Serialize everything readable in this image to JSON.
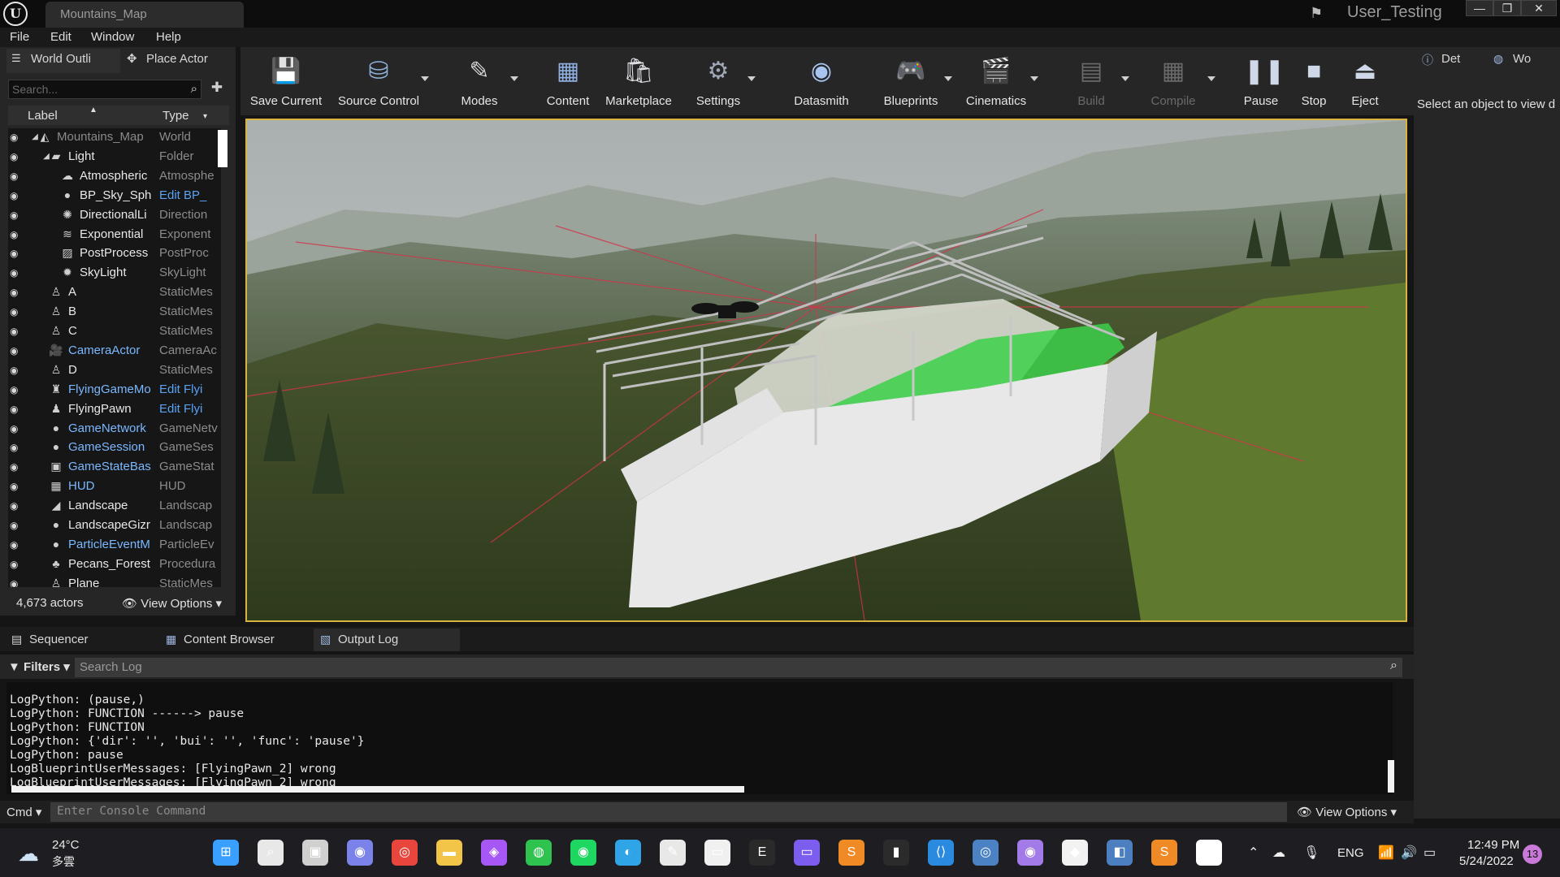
{
  "window": {
    "tab_title": "Mountains_Map",
    "user": "User_Testing",
    "minimize": "—",
    "restore": "❐",
    "close": "✕"
  },
  "menu": [
    "File",
    "Edit",
    "Window",
    "Help"
  ],
  "outliner": {
    "tab_label": "World Outli",
    "place_actor_label": "Place Actor",
    "search_placeholder": "Search...",
    "col_label": "Label",
    "col_type": "Type",
    "rows": [
      {
        "label": "Mountains_Map",
        "type": "World",
        "indent": 0,
        "icon": "map-icon",
        "dim": true
      },
      {
        "label": "Light",
        "type": "Folder",
        "indent": 1,
        "icon": "folder-icon"
      },
      {
        "label": "Atmospheric",
        "type": "Atmosphe",
        "indent": 2,
        "icon": "sky-atmosphere-icon"
      },
      {
        "label": "BP_Sky_Sph",
        "type": "Edit BP_",
        "indent": 2,
        "icon": "sphere-icon",
        "type_link": true
      },
      {
        "label": "DirectionalLi",
        "type": "Direction",
        "indent": 2,
        "icon": "sun-icon"
      },
      {
        "label": "Exponential",
        "type": "Exponent",
        "indent": 2,
        "icon": "fog-icon"
      },
      {
        "label": "PostProcess",
        "type": "PostProc",
        "indent": 2,
        "icon": "post-process-icon"
      },
      {
        "label": "SkyLight",
        "type": "SkyLight",
        "indent": 2,
        "icon": "skylight-icon"
      },
      {
        "label": "A",
        "type": "StaticMes",
        "indent": 1,
        "icon": "static-mesh-icon"
      },
      {
        "label": "B",
        "type": "StaticMes",
        "indent": 1,
        "icon": "static-mesh-icon"
      },
      {
        "label": "C",
        "type": "StaticMes",
        "indent": 1,
        "icon": "static-mesh-icon"
      },
      {
        "label": "CameraActor",
        "type": "CameraAc",
        "indent": 1,
        "icon": "camera-icon",
        "label_blue": true
      },
      {
        "label": "D",
        "type": "StaticMes",
        "indent": 1,
        "icon": "static-mesh-icon"
      },
      {
        "label": "FlyingGameMo",
        "type": "Edit Flyi",
        "indent": 1,
        "icon": "game-mode-icon",
        "label_blue": true,
        "type_link": true
      },
      {
        "label": "FlyingPawn",
        "type": "Edit Flyi",
        "indent": 1,
        "icon": "pawn-icon",
        "type_link": true
      },
      {
        "label": "GameNetwork",
        "type": "GameNetv",
        "indent": 1,
        "icon": "sphere-icon",
        "label_blue": true
      },
      {
        "label": "GameSession",
        "type": "GameSes",
        "indent": 1,
        "icon": "sphere-icon",
        "label_blue": true
      },
      {
        "label": "GameStateBas",
        "type": "GameStat",
        "indent": 1,
        "icon": "game-state-icon",
        "label_blue": true
      },
      {
        "label": "HUD",
        "type": "HUD",
        "indent": 1,
        "icon": "hud-icon",
        "label_blue": true
      },
      {
        "label": "Landscape",
        "type": "Landscap",
        "indent": 1,
        "icon": "landscape-icon"
      },
      {
        "label": "LandscapeGizr",
        "type": "Landscap",
        "indent": 1,
        "icon": "sphere-icon"
      },
      {
        "label": "ParticleEventM",
        "type": "ParticleEv",
        "indent": 1,
        "icon": "sphere-icon",
        "label_blue": true
      },
      {
        "label": "Pecans_Forest",
        "type": "Procedura",
        "indent": 1,
        "icon": "forest-icon"
      },
      {
        "label": "Plane",
        "type": "StaticMes",
        "indent": 1,
        "icon": "static-mesh-icon"
      }
    ],
    "actor_count": "4,673 actors",
    "view_options": "View Options"
  },
  "toolbar": [
    {
      "label": "Save Current",
      "icon": "save-icon",
      "color": "#c9d6e8"
    },
    {
      "label": "Source Control",
      "icon": "source-control-icon",
      "color": "#8fb0d8",
      "caret": true
    },
    {
      "label": "Modes",
      "icon": "modes-icon",
      "color": "#d8d8d8",
      "caret": true
    },
    {
      "label": "Content",
      "icon": "content-icon",
      "color": "#8fb0e0"
    },
    {
      "label": "Marketplace",
      "icon": "marketplace-icon",
      "color": "#e0e0e6"
    },
    {
      "label": "Settings",
      "icon": "settings-icon",
      "color": "#a0a8b8",
      "caret": true
    },
    {
      "label": "Datasmith",
      "icon": "datasmith-icon",
      "color": "#a8c4f0"
    },
    {
      "label": "Blueprints",
      "icon": "blueprints-icon",
      "color": "#8fa8d0",
      "caret": true
    },
    {
      "label": "Cinematics",
      "icon": "cinematics-icon",
      "color": "#b8c0d8",
      "caret": true
    },
    {
      "label": "Build",
      "icon": "build-icon",
      "color": "#6a6a6a",
      "caret": true,
      "disabled": true
    },
    {
      "label": "Compile",
      "icon": "compile-icon",
      "color": "#6a6a6a",
      "caret": true,
      "disabled": true
    },
    {
      "label": "Pause",
      "icon": "pause-icon",
      "color": "#cfd8e8"
    },
    {
      "label": "Stop",
      "icon": "stop-icon",
      "color": "#cfd8e8"
    },
    {
      "label": "Eject",
      "icon": "eject-icon",
      "color": "#cfd8e8"
    }
  ],
  "details": {
    "tab_details": "Det",
    "tab_world": "Wo",
    "hint": "Select an object to view d"
  },
  "bottom_tabs": [
    "Sequencer",
    "Content Browser",
    "Output Log"
  ],
  "log": {
    "filters": "Filters",
    "search_placeholder": "Search Log",
    "lines": [
      "LogPython: (pause,)",
      "LogPython: FUNCTION ------> pause",
      "LogPython: FUNCTION",
      "LogPython: {'dir': '', 'bui': '', 'func': 'pause'}",
      "LogPython: pause",
      "LogBlueprintUserMessages: [FlyingPawn_2] wrong",
      "LogBlueprintUserMessages: [FlyingPawn_2] wrong"
    ],
    "cmd_label": "Cmd",
    "cmd_placeholder": "Enter Console Command",
    "view_options": "View Options"
  },
  "taskbar": {
    "temp": "24°C",
    "weather": "多雲",
    "lang": "ENG",
    "time": "12:49 PM",
    "date": "5/24/2022",
    "notifications": "13",
    "apps": [
      {
        "name": "start-icon",
        "glyph": "⊞",
        "color": "#3aa0ff"
      },
      {
        "name": "search-icon",
        "glyph": "⌕",
        "color": "#e8e8e8"
      },
      {
        "name": "task-view-icon",
        "glyph": "▣",
        "color": "#d0d0d0"
      },
      {
        "name": "teams-chat-icon",
        "glyph": "◉",
        "color": "#7b83eb"
      },
      {
        "name": "chrome-icon",
        "glyph": "◎",
        "color": "#e8453c"
      },
      {
        "name": "file-explorer-icon",
        "glyph": "▬",
        "color": "#f2c447"
      },
      {
        "name": "messenger-icon",
        "glyph": "◈",
        "color": "#a657f5"
      },
      {
        "name": "line-icon",
        "glyph": "◍",
        "color": "#2ec24f"
      },
      {
        "name": "spotify-icon",
        "glyph": "◉",
        "color": "#1ed760"
      },
      {
        "name": "edge-icon",
        "glyph": "◐",
        "color": "#2fa5e8"
      },
      {
        "name": "inkscape-icon",
        "glyph": "✎",
        "color": "#e8e8e8"
      },
      {
        "name": "oculus-icon",
        "glyph": "▭",
        "color": "#f0f0f0"
      },
      {
        "name": "epic-games-icon",
        "glyph": "E",
        "color": "#2a2a2a"
      },
      {
        "name": "remote-app-icon",
        "glyph": "▭",
        "color": "#7d5cf0"
      },
      {
        "name": "sublime-icon",
        "glyph": "S",
        "color": "#f08a24"
      },
      {
        "name": "terminal-icon",
        "glyph": "▮",
        "color": "#2b2b2b"
      },
      {
        "name": "vscode-icon",
        "glyph": "⟨⟩",
        "color": "#2a8ae0"
      },
      {
        "name": "steam-icon",
        "glyph": "◎",
        "color": "#4a82c4"
      },
      {
        "name": "github-icon",
        "glyph": "◉",
        "color": "#a37be8"
      },
      {
        "name": "git-icon",
        "glyph": "◆",
        "color": "#f2f2f2"
      },
      {
        "name": "python-icon",
        "glyph": "◧",
        "color": "#4b7fc0"
      },
      {
        "name": "sublime-merge-icon",
        "glyph": "S",
        "color": "#f08a24"
      },
      {
        "name": "unreal-engine-icon",
        "glyph": "U",
        "color": "#ffffff"
      }
    ]
  }
}
